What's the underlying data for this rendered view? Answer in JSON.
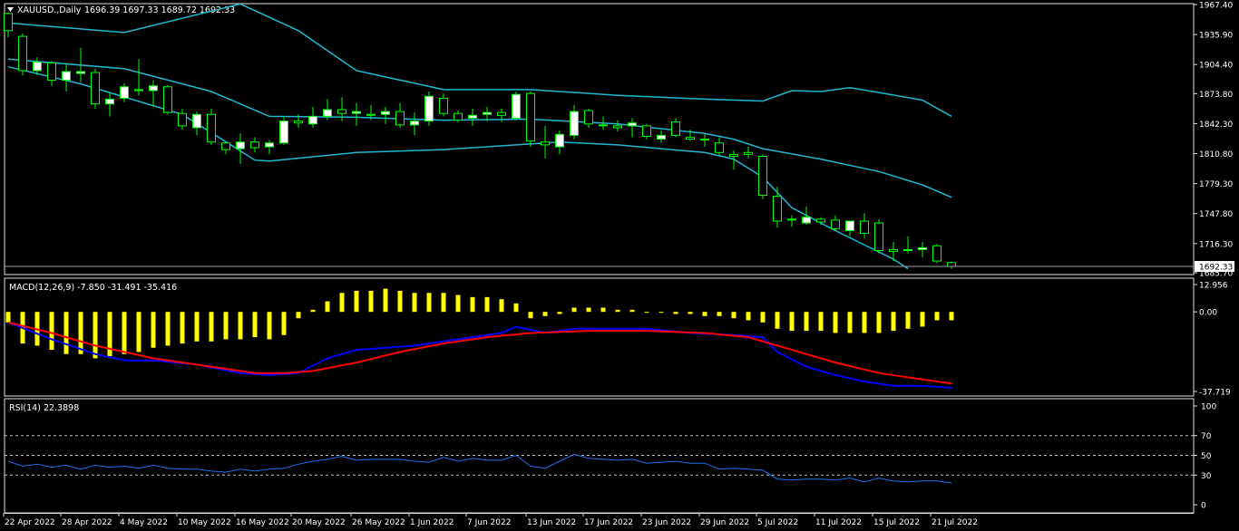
{
  "colors": {
    "background": "#000000",
    "frame": "#e0e0e0",
    "text": "#ffffff",
    "bull_candle": "#ffffff",
    "bear_candle": "#000000",
    "candle_wick": "#00ff00",
    "bollinger": "#20b8d0",
    "macd_histogram": "#ffff00",
    "macd_line": "#0000ff",
    "signal_line": "#ff0000",
    "rsi_line": "#1e6ff0",
    "rsi_level": "#c0c0c0"
  },
  "header": {
    "symbol": "XAUUSD.,Daily",
    "ohlc": "1696.39 1697.33 1689.72 1692.33"
  },
  "price_axis": {
    "ticks": [
      "1967.40",
      "1935.90",
      "1904.40",
      "1873.80",
      "1842.30",
      "1810.80",
      "1779.30",
      "1747.80",
      "1716.30",
      "1685.70"
    ],
    "current_price": "1692.33"
  },
  "macd_panel": {
    "label": "MACD(12,26,9) -7.850 -31.491 -35.416",
    "ticks": [
      "12.956",
      "0.00",
      "-37.719"
    ]
  },
  "rsi_panel": {
    "label": "RSI(14) 22.3898",
    "ticks": [
      "100",
      "70",
      "50",
      "30",
      "0"
    ]
  },
  "date_axis": {
    "labels": [
      "22 Apr 2022",
      "28 Apr 2022",
      "4 May 2022",
      "10 May 2022",
      "16 May 2022",
      "20 May 2022",
      "26 May 2022",
      "1 Jun 2022",
      "7 Jun 2022",
      "13 Jun 2022",
      "17 Jun 2022",
      "23 Jun 2022",
      "29 Jun 2022",
      "5 Jul 2022",
      "11 Jul 2022",
      "15 Jul 2022",
      "21 Jul 2022"
    ]
  },
  "chart_data": [
    {
      "type": "candlestick",
      "title": "XAUUSD.,Daily",
      "ylim": [
        1685.7,
        1967.4
      ],
      "ohlc": [
        [
          1958,
          1959,
          1933,
          1940
        ],
        [
          1934,
          1937,
          1893,
          1898
        ],
        [
          1898,
          1912,
          1893,
          1907
        ],
        [
          1906,
          1908,
          1882,
          1888
        ],
        [
          1888,
          1905,
          1876,
          1897
        ],
        [
          1895,
          1922,
          1886,
          1897
        ],
        [
          1896,
          1900,
          1858,
          1863
        ],
        [
          1863,
          1875,
          1850,
          1868
        ],
        [
          1869,
          1885,
          1865,
          1881
        ],
        [
          1878,
          1910,
          1872,
          1878
        ],
        [
          1877,
          1888,
          1860,
          1882
        ],
        [
          1881,
          1883,
          1852,
          1854
        ],
        [
          1853,
          1858,
          1836,
          1840
        ],
        [
          1838,
          1855,
          1830,
          1852
        ],
        [
          1852,
          1858,
          1820,
          1823
        ],
        [
          1822,
          1823,
          1810,
          1815
        ],
        [
          1816,
          1832,
          1800,
          1823
        ],
        [
          1823,
          1828,
          1812,
          1817
        ],
        [
          1818,
          1825,
          1810,
          1822
        ],
        [
          1822,
          1850,
          1820,
          1845
        ],
        [
          1845,
          1852,
          1838,
          1843
        ],
        [
          1842,
          1860,
          1838,
          1850
        ],
        [
          1850,
          1868,
          1846,
          1857
        ],
        [
          1857,
          1870,
          1845,
          1853
        ],
        [
          1853,
          1864,
          1840,
          1855
        ],
        [
          1852,
          1862,
          1846,
          1851
        ],
        [
          1852,
          1860,
          1842,
          1855
        ],
        [
          1855,
          1864,
          1838,
          1841
        ],
        [
          1841,
          1854,
          1830,
          1845
        ],
        [
          1845,
          1876,
          1840,
          1871
        ],
        [
          1869,
          1874,
          1850,
          1853
        ],
        [
          1853,
          1856,
          1844,
          1846
        ],
        [
          1848,
          1858,
          1840,
          1851
        ],
        [
          1852,
          1860,
          1845,
          1854
        ],
        [
          1854,
          1858,
          1844,
          1851
        ],
        [
          1848,
          1876,
          1846,
          1873
        ],
        [
          1874,
          1876,
          1818,
          1824
        ],
        [
          1823,
          1840,
          1806,
          1820
        ],
        [
          1818,
          1835,
          1810,
          1831
        ],
        [
          1830,
          1862,
          1826,
          1855
        ],
        [
          1856,
          1858,
          1838,
          1842
        ],
        [
          1840,
          1850,
          1836,
          1841
        ],
        [
          1840,
          1846,
          1834,
          1838
        ],
        [
          1840,
          1848,
          1828,
          1843
        ],
        [
          1840,
          1842,
          1826,
          1829
        ],
        [
          1826,
          1835,
          1822,
          1830
        ],
        [
          1844,
          1848,
          1828,
          1830
        ],
        [
          1828,
          1836,
          1824,
          1826
        ],
        [
          1826,
          1832,
          1818,
          1826
        ],
        [
          1822,
          1828,
          1808,
          1812
        ],
        [
          1810,
          1814,
          1794,
          1808
        ],
        [
          1812,
          1818,
          1806,
          1810
        ],
        [
          1808,
          1810,
          1763,
          1767
        ],
        [
          1766,
          1776,
          1733,
          1740
        ],
        [
          1742,
          1746,
          1734,
          1741
        ],
        [
          1738,
          1755,
          1736,
          1744
        ],
        [
          1742,
          1744,
          1736,
          1739
        ],
        [
          1741,
          1746,
          1730,
          1732
        ],
        [
          1730,
          1740,
          1724,
          1740
        ],
        [
          1740,
          1748,
          1722,
          1727
        ],
        [
          1738,
          1742,
          1706,
          1709
        ],
        [
          1710,
          1718,
          1698,
          1708
        ],
        [
          1709,
          1724,
          1706,
          1710
        ],
        [
          1710,
          1718,
          1702,
          1712
        ],
        [
          1714,
          1716,
          1696,
          1698
        ],
        [
          1696.39,
          1697.33,
          1689.72,
          1692.33
        ]
      ],
      "bollinger_upper": [
        [
          0,
          1948
        ],
        [
          8,
          1938
        ],
        [
          16,
          1968
        ],
        [
          20,
          1940
        ],
        [
          24,
          1898
        ],
        [
          30,
          1878
        ],
        [
          36,
          1878
        ],
        [
          42,
          1872
        ],
        [
          48,
          1868
        ],
        [
          52,
          1866
        ],
        [
          54,
          1877
        ],
        [
          56,
          1876
        ],
        [
          58,
          1880
        ],
        [
          60,
          1875
        ],
        [
          63,
          1867
        ],
        [
          65,
          1850
        ]
      ],
      "bollinger_middle": [
        [
          0,
          1910
        ],
        [
          8,
          1900
        ],
        [
          14,
          1876
        ],
        [
          18,
          1850
        ],
        [
          24,
          1849
        ],
        [
          30,
          1846
        ],
        [
          36,
          1847
        ],
        [
          42,
          1842
        ],
        [
          48,
          1832
        ],
        [
          50,
          1826
        ],
        [
          52,
          1816
        ],
        [
          56,
          1805
        ],
        [
          60,
          1792
        ],
        [
          63,
          1778
        ],
        [
          65,
          1765
        ]
      ],
      "bollinger_lower": [
        [
          0,
          1902
        ],
        [
          5,
          1884
        ],
        [
          12,
          1852
        ],
        [
          17,
          1804
        ],
        [
          18,
          1803
        ],
        [
          24,
          1812
        ],
        [
          30,
          1815
        ],
        [
          35,
          1820
        ],
        [
          38,
          1823
        ],
        [
          42,
          1820
        ],
        [
          48,
          1812
        ],
        [
          50,
          1805
        ],
        [
          52,
          1786
        ],
        [
          54,
          1754
        ],
        [
          57,
          1730
        ],
        [
          61,
          1700
        ],
        [
          62,
          1690
        ]
      ]
    },
    {
      "type": "bar",
      "title": "MACD(12,26,9)",
      "ylim": [
        -37.719,
        12.956
      ],
      "values": [
        -5,
        -15,
        -16,
        -18,
        -20,
        -20,
        -22,
        -21,
        -20,
        -19,
        -17,
        -16,
        -15,
        -14,
        -14,
        -13,
        -13,
        -12,
        -13,
        -11,
        -3,
        1,
        5,
        9,
        10,
        10,
        11,
        10,
        9,
        9,
        9,
        8,
        7,
        7,
        6,
        4,
        -3,
        -2,
        -1,
        2,
        2,
        2,
        1,
        1,
        0,
        0,
        -1,
        -1,
        -2,
        -2,
        -3,
        -4,
        -5,
        -8,
        -9,
        -9,
        -9,
        -10,
        -10,
        -10,
        -10,
        -9,
        -8,
        -7,
        -4,
        -4
      ],
      "series": [
        {
          "name": "MACD",
          "points": [
            [
              0,
              -5
            ],
            [
              3,
              -13
            ],
            [
              6,
              -20
            ],
            [
              8,
              -23
            ],
            [
              10,
              -23
            ],
            [
              13,
              -25
            ],
            [
              16,
              -29
            ],
            [
              18,
              -30
            ],
            [
              20,
              -29
            ],
            [
              22,
              -22
            ],
            [
              24,
              -18
            ],
            [
              26,
              -17
            ],
            [
              28,
              -16
            ],
            [
              30,
              -14
            ],
            [
              32,
              -12
            ],
            [
              34,
              -10
            ],
            [
              35,
              -7
            ],
            [
              37,
              -10
            ],
            [
              39,
              -8
            ],
            [
              41,
              -8
            ],
            [
              44,
              -8
            ],
            [
              47,
              -10
            ],
            [
              50,
              -11
            ],
            [
              52,
              -12
            ],
            [
              53,
              -19
            ],
            [
              55,
              -26
            ],
            [
              57,
              -30
            ],
            [
              59,
              -33
            ],
            [
              61,
              -35
            ],
            [
              63,
              -35
            ],
            [
              65,
              -36
            ]
          ]
        },
        {
          "name": "Signal",
          "points": [
            [
              0,
              -5
            ],
            [
              3,
              -10
            ],
            [
              6,
              -16
            ],
            [
              10,
              -22
            ],
            [
              14,
              -26
            ],
            [
              17,
              -29
            ],
            [
              19,
              -29
            ],
            [
              21,
              -28
            ],
            [
              24,
              -24
            ],
            [
              27,
              -19
            ],
            [
              30,
              -15
            ],
            [
              33,
              -12
            ],
            [
              36,
              -10
            ],
            [
              40,
              -9
            ],
            [
              44,
              -9
            ],
            [
              48,
              -10
            ],
            [
              51,
              -12
            ],
            [
              54,
              -18
            ],
            [
              57,
              -24
            ],
            [
              60,
              -29
            ],
            [
              63,
              -32
            ],
            [
              65,
              -34
            ]
          ]
        }
      ]
    },
    {
      "type": "line",
      "title": "RSI(14)",
      "ylim": [
        0,
        100
      ],
      "levels": [
        30,
        50,
        70
      ],
      "values": [
        44,
        39,
        41,
        38,
        40,
        36,
        40,
        38,
        39,
        37,
        40,
        37,
        36,
        36,
        34,
        33,
        36,
        34,
        36,
        37,
        41,
        44,
        46,
        49,
        45,
        46,
        46,
        46,
        44,
        43,
        48,
        44,
        47,
        45,
        45,
        50,
        39,
        37,
        44,
        51,
        47,
        46,
        45,
        46,
        42,
        43,
        44,
        42,
        42,
        36,
        37,
        36,
        35,
        26,
        25,
        26,
        26,
        25,
        27,
        23,
        27,
        24,
        23,
        24,
        24,
        22
      ]
    }
  ]
}
